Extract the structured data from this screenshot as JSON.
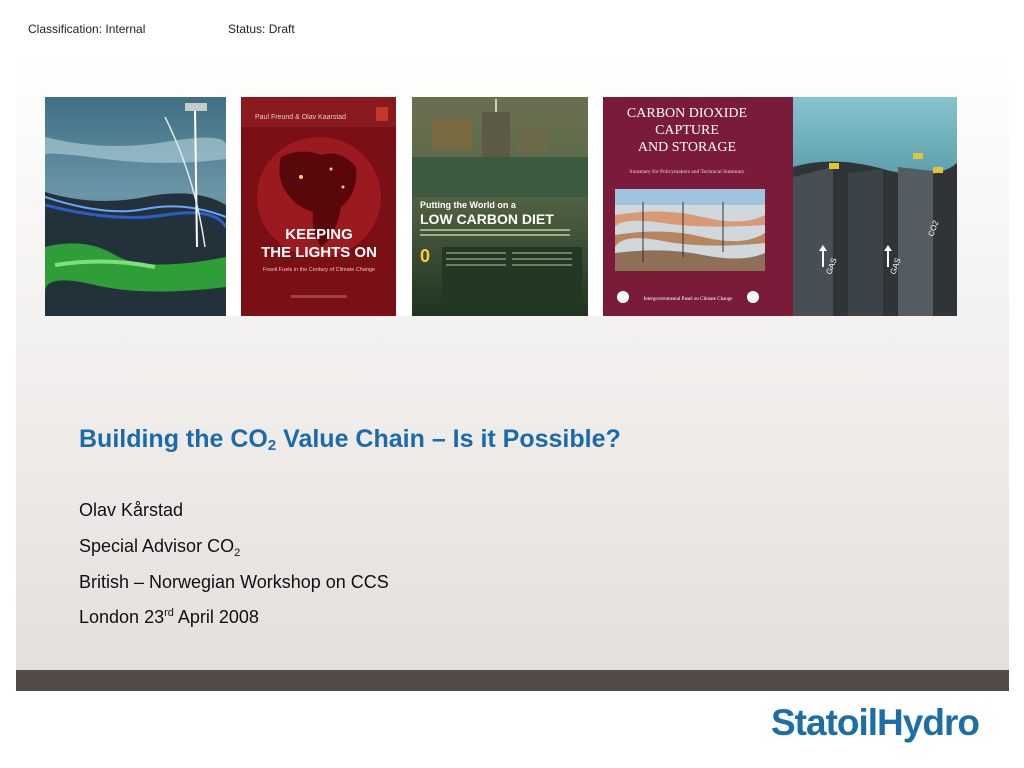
{
  "header": {
    "classification": "Classification: Internal",
    "status": "Status: Draft"
  },
  "images": [
    {
      "name": "subsea-pipeline-illustration"
    },
    {
      "name": "book-cover-keeping-the-lights-on",
      "authors": "Paul Freund & Olav Kaarstad",
      "title_line1": "KEEPING",
      "title_line2": "THE LIGHTS ON",
      "subtitle": "Fossil Fuels in the Century of Climate Change"
    },
    {
      "name": "magazine-cover-low-carbon-diet",
      "headline1": "Putting the World on a",
      "headline2": "LOW CARBON DIET",
      "number": "0"
    },
    {
      "name": "report-cover-ccs",
      "title_line1": "CARBON DIOXIDE",
      "title_line2": "CAPTURE",
      "title_line3": "AND STORAGE",
      "subtitle": "Summary for Policymakers and Technical Summary",
      "footer": "Intergovernmental Panel on Climate Change"
    },
    {
      "name": "gas-co2-injection-illustration",
      "label_gas": "GAS",
      "label_co2": "CO2"
    }
  ],
  "title": {
    "main": "Building the CO",
    "sub": "2",
    "rest": " Value Chain – Is it Possible?"
  },
  "presenter": {
    "name": "Olav Kårstad",
    "role_main": "Special Advisor CO",
    "role_sub": "2",
    "event": "British – Norwegian Workshop on CCS",
    "date_main": "London 23",
    "date_sup": "rd",
    "date_rest": " April 2008"
  },
  "logo": {
    "text": "StatoilHydro"
  },
  "colors": {
    "title": "#1a6aae",
    "band": "#534b46",
    "logo": "#1b6fa6"
  }
}
